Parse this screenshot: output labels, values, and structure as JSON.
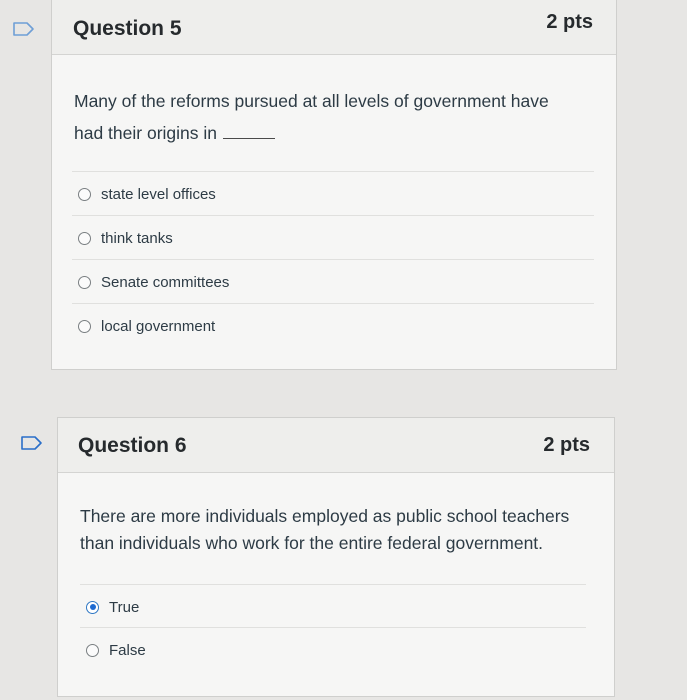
{
  "questions": [
    {
      "title": "Question 5",
      "points": "2 pts",
      "text_line1": "Many of the reforms pursued at all levels of government have",
      "text_line2": "had their origins in",
      "answers": [
        {
          "label": "state level offices",
          "selected": false
        },
        {
          "label": "think tanks",
          "selected": false
        },
        {
          "label": "Senate committees",
          "selected": false
        },
        {
          "label": "local government",
          "selected": false
        }
      ]
    },
    {
      "title": "Question 6",
      "points": "2 pts",
      "text_line1": "There are more individuals employed as public school teachers",
      "text_line2": "than individuals who work for the entire federal government.",
      "answers": [
        {
          "label": "True",
          "selected": true
        },
        {
          "label": "False",
          "selected": false
        }
      ]
    }
  ],
  "colors": {
    "flag_outline": "#2a6fc9",
    "selected_radio": "#1d6ad1"
  }
}
